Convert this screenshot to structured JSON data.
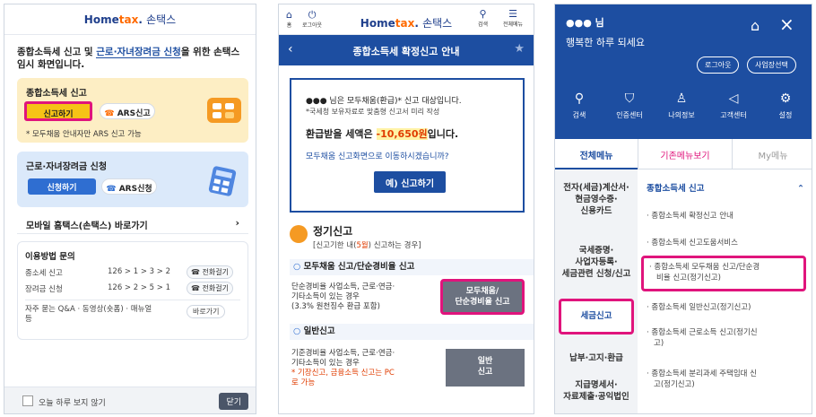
{
  "panel1": {
    "logo": {
      "home": "Home",
      "tax": "tax",
      "name": "손택스"
    },
    "intro": {
      "pre": "종합소득세 신고 및 ",
      "em": "근로·자녀장려금 신청",
      "post": "을 위한 손택스 임시 화면입니다."
    },
    "card_income": {
      "title": "종합소득세 신고",
      "report_btn": "신고하기",
      "ars_btn": "ARS신고",
      "note": "* 모두채움 안내자만 ARS 신고 가능"
    },
    "card_incentive": {
      "title": "근로·자녀장려금 신청",
      "apply_btn": "신청하기",
      "ars_btn": "ARS신청"
    },
    "mobile_link": "모바일 홈택스(손택스) 바로가기",
    "inquiry": {
      "title": "이용방법 문의",
      "rows": [
        {
          "label": "종소세 신고",
          "path": "126 > 1 > 3 > 2",
          "btn": "전화걸기"
        },
        {
          "label": "장려금 신청",
          "path": "126 > 2 > 5 > 1",
          "btn": "전화걸기"
        }
      ],
      "faq": "자주 묻는 Q&A · 동영상(숏폼) · 매뉴얼 등",
      "faq_btn": "바로가기"
    },
    "footer": {
      "checkbox_label": "오늘 하루 보지 않기",
      "close_btn": "닫기"
    }
  },
  "panel2": {
    "top": {
      "home_label": "홈",
      "logout_label": "로그아웃",
      "search_label": "검색",
      "menu_label": "전체메뉴"
    },
    "logo": {
      "home": "Home",
      "tax": "tax",
      "name": "손택스"
    },
    "bar_title": "종합소득세 확정신고 안내",
    "notice": {
      "line1": "●●● 님은 모두채움(환급)* 신고 대상입니다.",
      "line2": "*국세청 보유자료로 맞춤형 신고서 미리 작성",
      "refund_pre": "환급받을 세액은 ",
      "refund_amt": "-10,650원",
      "refund_post": "입니다.",
      "question": "모두채움 신고화면으로 이동하시겠습니까?",
      "yes_btn": "예) 신고하기"
    },
    "section": {
      "title": "정기신고",
      "sub_pre": "[신고기한 내(",
      "sub_red": "5월",
      "sub_post": ") 신고하는 경우]"
    },
    "sub1": {
      "title": "모두채움 신고/단순경비율 신고",
      "desc1": "단순경비율 사업소득, 근로·연금·",
      "desc2": "기타소득이 있는 경우",
      "desc3": "(3.3% 원천징수 환급 포함)",
      "btn1": "모두채움/",
      "btn2": "단순경비율 신고"
    },
    "sub2": {
      "title": "일반신고",
      "desc1": "기준경비율 사업소득, 근로·연금·",
      "desc2": "기타소득이 있는 경우",
      "note1": "* 기장신고, 금융소득 신고는 PC",
      "note2": "로 가능",
      "btn1": "일반",
      "btn2": "신고"
    }
  },
  "panel3": {
    "user": "●●● 님",
    "greeting": "행복한 하루 되세요",
    "logout_btn": "로그아웃",
    "biz_btn": "사업장선택",
    "quick": [
      {
        "label": "검색",
        "icon": "search-icon"
      },
      {
        "label": "인증센터",
        "icon": "shield-icon"
      },
      {
        "label": "나의정보",
        "icon": "user-icon"
      },
      {
        "label": "고객센터",
        "icon": "megaphone-icon"
      },
      {
        "label": "설정",
        "icon": "gear-icon"
      }
    ],
    "tabs": [
      "전체메뉴",
      "기존메뉴보기",
      "My메뉴"
    ],
    "left_menu": [
      "전자(세금)계산서·",
      "현금영수증·",
      "신용카드",
      "국세증명·",
      "사업자등록·",
      "세금관련 신청/신고",
      "세금신고",
      "납부·고지·환급",
      "지급명세서·",
      "자료제출·공익법인"
    ],
    "group_title": "종합소득세 신고",
    "items": [
      "· 종합소득세 확정신고 안내",
      "· 종합소득세 신고도움서비스",
      "· 종합소득세 모두채움 신고/단순경",
      "비율 신고(정기신고)",
      "· 종합소득세 일반신고(정기신고)",
      "· 종합소득세 근로소득 신고(정기신",
      "고)",
      "· 종합소득세 분리과세 주택임대 신",
      "고(정기신고)"
    ]
  }
}
